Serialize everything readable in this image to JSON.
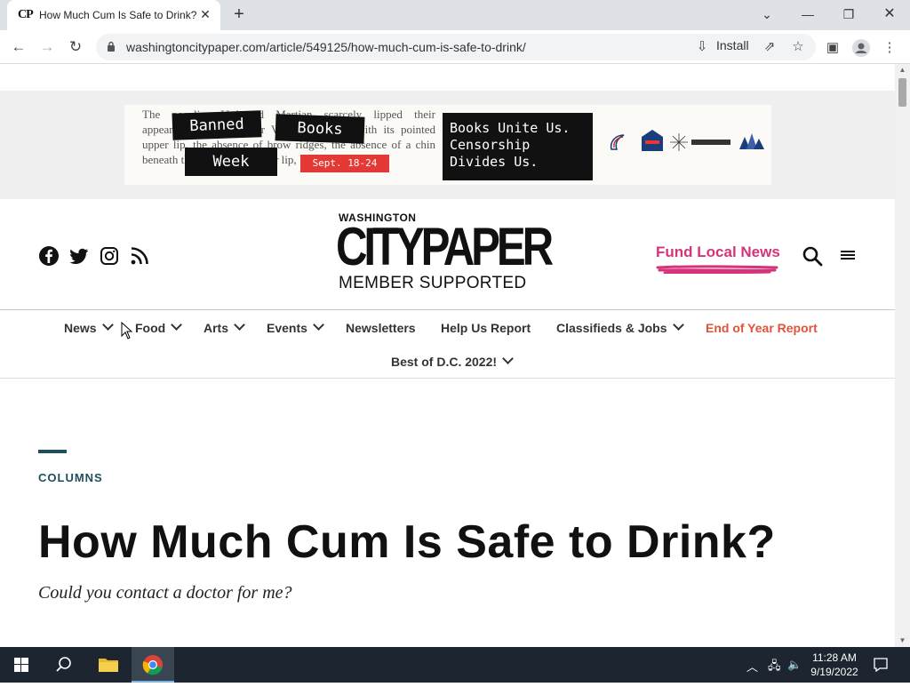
{
  "browser": {
    "tab_favicon": "CP",
    "tab_title": "How Much Cum Is Safe to Drink?",
    "url": "washingtoncitypaper.com/article/549125/how-much-cum-is-safe-to-drink/",
    "install_label": "Install"
  },
  "ad": {
    "background_text": "The peculiar V-shaped Martian scarcely lipped their appearance. The peculiar V-shaped mouth with its pointed upper lip, the absence of brow ridges, the absence of a chin beneath the wedge-like lower lip,",
    "tags": [
      "Banned",
      "Books",
      "Week"
    ],
    "date": "Sept. 18-24",
    "block_lines": [
      "Books Unite Us.",
      "Censorship",
      "Divides Us."
    ],
    "sponsors": [
      "DC Public Library",
      "DC Public Library Foundation",
      "Institute of Museum and Library Services",
      "Mars Area D.C."
    ]
  },
  "header": {
    "brand_small": "WASHINGTON",
    "brand_big": "CITYPAPER",
    "brand_member": "MEMBER SUPPORTED",
    "fund_label": "Fund Local News",
    "social": [
      "facebook-icon",
      "twitter-icon",
      "instagram-icon",
      "rss-icon"
    ]
  },
  "nav": {
    "items": [
      {
        "label": "News",
        "dropdown": true
      },
      {
        "label": "Food",
        "dropdown": true
      },
      {
        "label": "Arts",
        "dropdown": true
      },
      {
        "label": "Events",
        "dropdown": true
      },
      {
        "label": "Newsletters",
        "dropdown": false
      },
      {
        "label": "Help Us Report",
        "dropdown": false
      },
      {
        "label": "Classifieds & Jobs",
        "dropdown": true
      },
      {
        "label": "End of Year Report",
        "dropdown": false
      },
      {
        "label": "Best of D.C. 2022!",
        "dropdown": true
      }
    ]
  },
  "article": {
    "kicker": "COLUMNS",
    "headline": "How Much Cum Is Safe to Drink?",
    "dek": "Could you contact a doctor for me?"
  },
  "taskbar": {
    "time": "11:28 AM",
    "date": "9/19/2022"
  },
  "colors": {
    "accent_pink": "#d6337a",
    "accent_red": "#e0533a",
    "kicker_teal": "#1f4e5f",
    "taskbar": "#1c2530"
  }
}
